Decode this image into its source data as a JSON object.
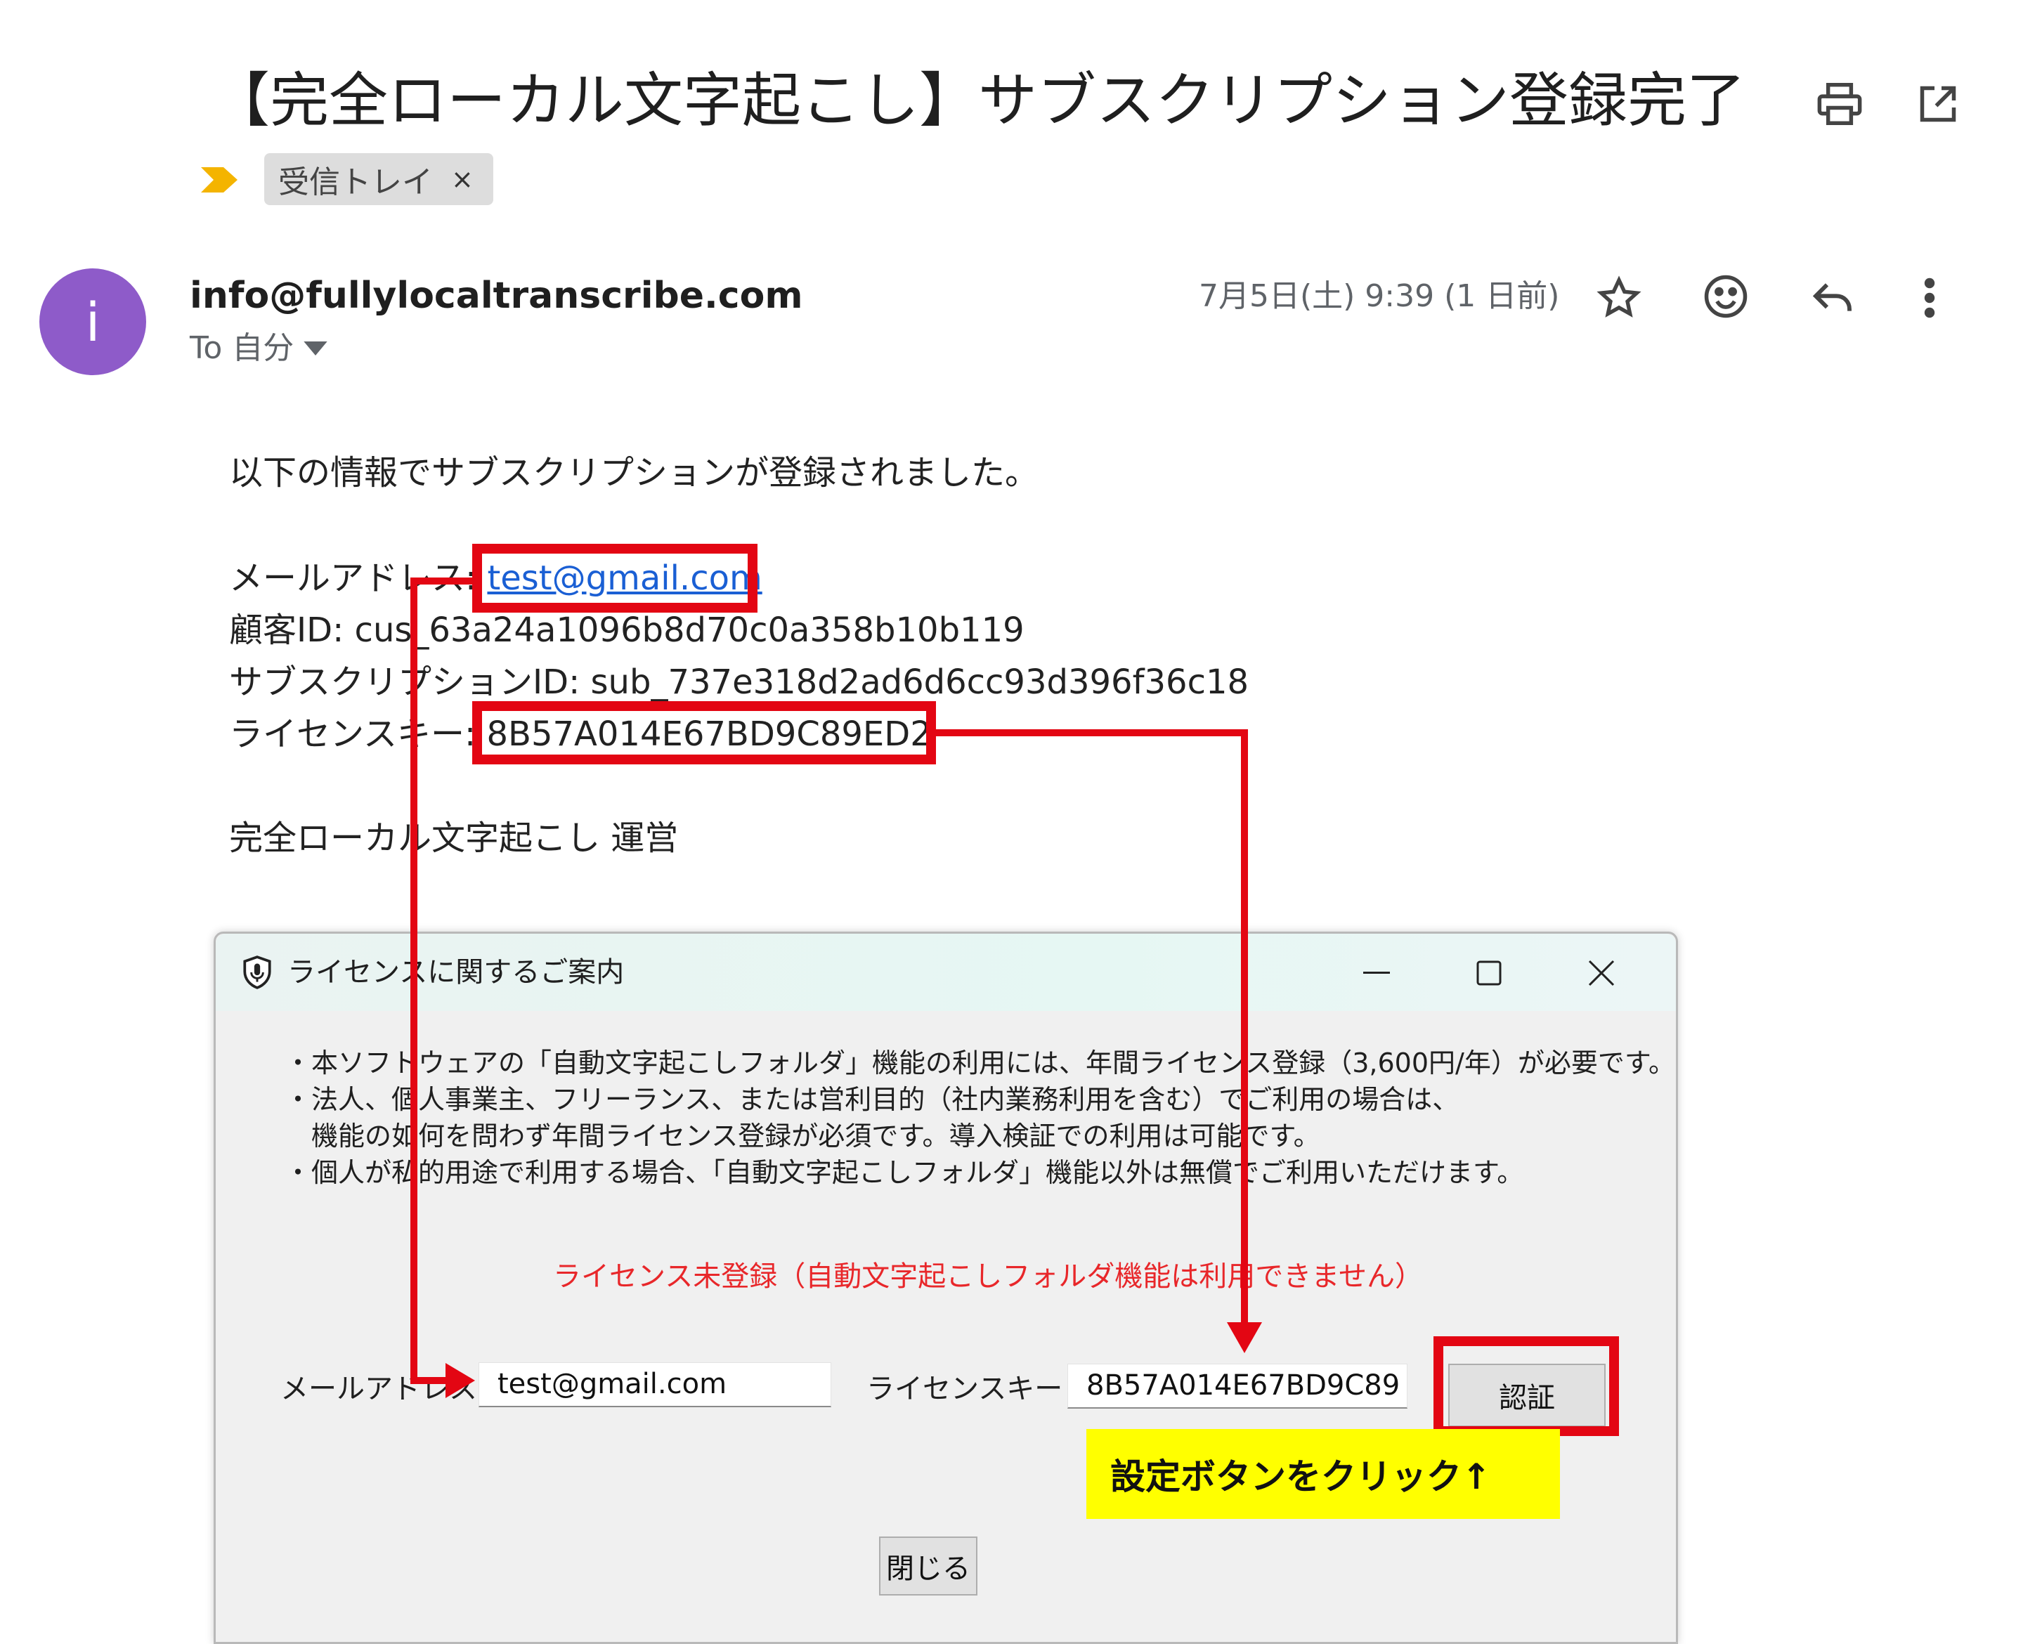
{
  "email": {
    "subject": "【完全ローカル文字起こし】サブスクリプション登録完了",
    "label_chip": "受信トレイ",
    "label_chip_close": "×",
    "avatar_letter": "i",
    "sender": "info@fullylocaltranscribe.com",
    "to": "To 自分",
    "date": "7月5日(土) 9:39 (1 日前)",
    "icons": [
      "print-icon",
      "open-in-new-window-icon",
      "importance-marker-icon",
      "star-icon",
      "emoji-reaction-icon",
      "reply-icon",
      "more-options-icon",
      "chevron-down-icon"
    ],
    "body": {
      "intro": "以下の情報でサブスクリプションが登録されました。",
      "email_label": "メールアドレス: ",
      "email_value": "test@gmail.com",
      "customer_id": "顧客ID: cus_63a24a1096b8d70c0a358b10b119",
      "subscription_id": "サブスクリプションID: sub_737e318d2ad6d6cc93d396f36c18",
      "license_label": "ライセンスキー: ",
      "license_value": "8B57A014E67BD9C89ED2",
      "signature": "完全ローカル文字起こし 運営"
    }
  },
  "dialog": {
    "title": "ライセンスに関するご案内",
    "window_buttons": {
      "minimize": "—",
      "maximize": "☐",
      "close": "✕"
    },
    "notice_lines": [
      "・本ソフトウェアの「自動文字起こしフォルダ」機能の利用には、年間ライセンス登録（3,600円/年）が必要です。",
      "・法人、個人事業主、フリーランス、または営利目的（社内業務利用を含む）でご利用の場合は、",
      "　機能の如何を問わず年間ライセンス登録が必須です。導入検証での利用は可能です。",
      "・個人が私的用途で利用する場合、「自動文字起こしフォルダ」機能以外は無償でご利用いただけます。"
    ],
    "status": "ライセンス未登録（自動文字起こしフォルダ機能は利用できません）",
    "email_label": "メールアドレス：",
    "email_value": "test@gmail.com",
    "license_label": "ライセンスキー：",
    "license_value": "8B57A014E67BD9C89",
    "auth_button": "認証",
    "close_button": "閉じる"
  },
  "annotation": {
    "callout": "設定ボタンをクリック↑",
    "color": "#e30613",
    "callout_bg": "#ffff00"
  }
}
